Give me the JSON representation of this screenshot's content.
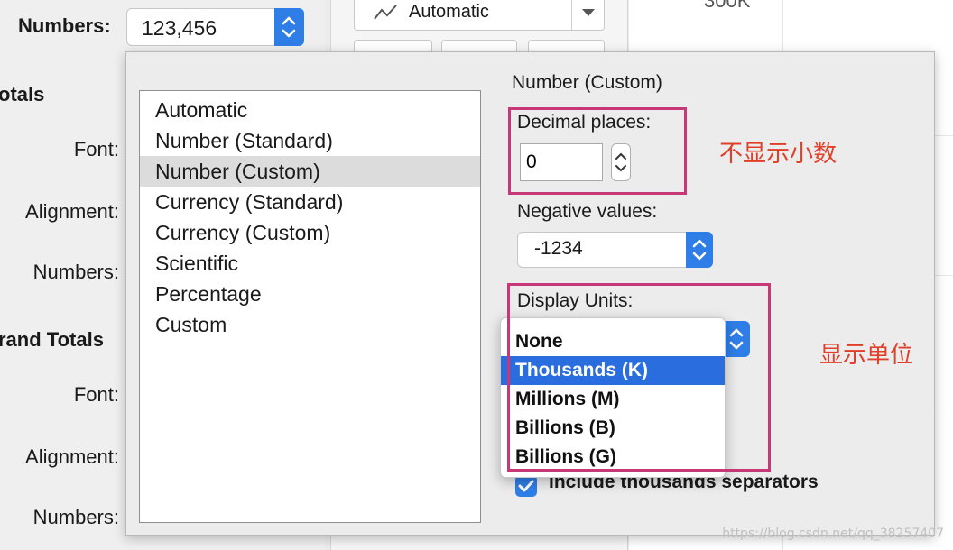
{
  "background": {
    "left_pane": {
      "numbers_label": "Numbers:",
      "numbers_value": "123,456",
      "totals_heading": "otals",
      "font_label_1": "Font:",
      "alignment_label_1": "Alignment:",
      "numbers_label_2": "Numbers:",
      "grand_totals_heading": "rand Totals",
      "font_label_2": "Font:",
      "alignment_label_2": "Alignment:",
      "numbers_label_3": "Numbers:"
    },
    "mid_pane": {
      "mark_type_value": "Automatic"
    },
    "right_pane": {
      "axis_value": "300K"
    }
  },
  "dialog": {
    "format_list": [
      "Automatic",
      "Number (Standard)",
      "Number (Custom)",
      "Currency (Standard)",
      "Currency (Custom)",
      "Scientific",
      "Percentage",
      "Custom"
    ],
    "selected_format": "Number (Custom)",
    "panel_title": "Number (Custom)",
    "decimal_places_label": "Decimal places:",
    "decimal_places_value": "0",
    "negative_values_label": "Negative values:",
    "negative_values_value": "-1234",
    "display_units_label": "Display Units:",
    "display_units_options": [
      "None",
      "Thousands (K)",
      "Millions (M)",
      "Billions (B)",
      "Billions (G)"
    ],
    "display_units_selected": "Thousands (K)",
    "thousands_separators_label": "Include thousands separators",
    "thousands_separators_checked": true
  },
  "annotations": {
    "no_decimals": "不显示小数",
    "display_units": "显示单位",
    "highlight_color": "#c83878",
    "text_color": "#e0402a"
  },
  "watermark": "https://blog.csdn.net/qq_38257407",
  "colors": {
    "accent": "#2f7ee8",
    "selection": "#2a6dde"
  }
}
